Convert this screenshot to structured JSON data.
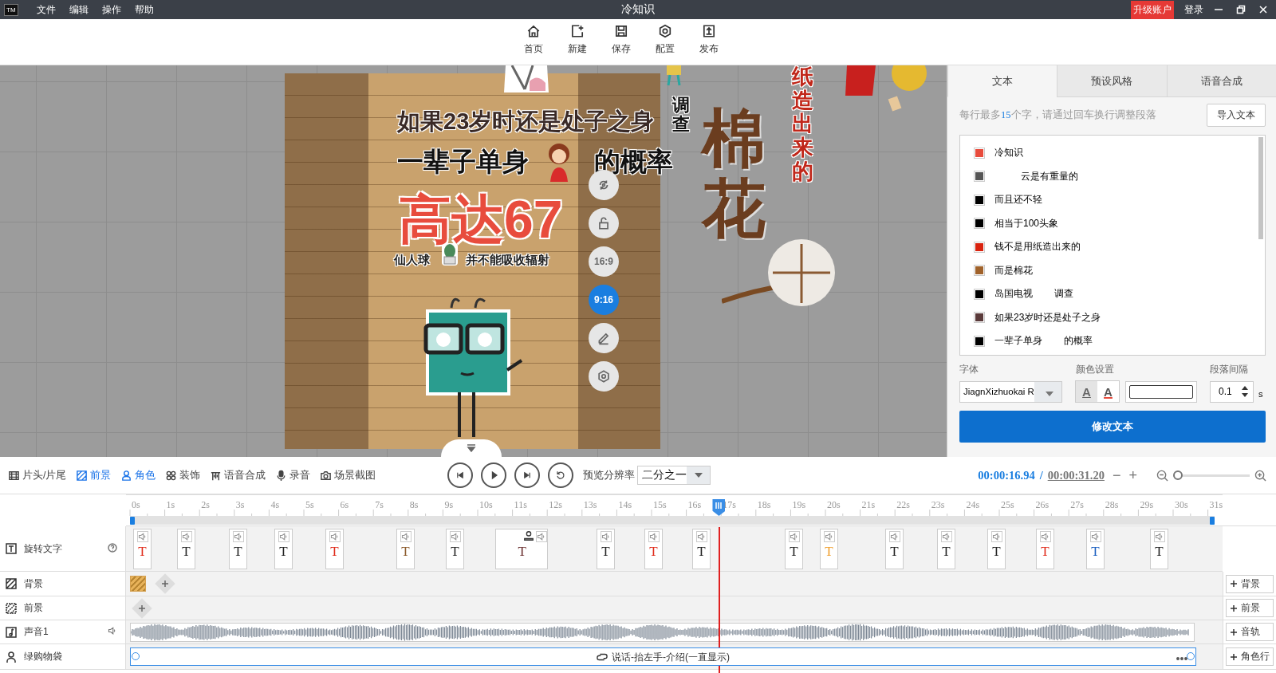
{
  "app": {
    "logo": "TM",
    "menu": [
      "文件",
      "编辑",
      "操作",
      "帮助"
    ],
    "title": "冷知识",
    "upgrade": "升级账户",
    "login": "登录"
  },
  "toolbar": [
    {
      "kind": "home",
      "label": "首页"
    },
    {
      "kind": "new",
      "label": "新建"
    },
    {
      "kind": "save",
      "label": "保存"
    },
    {
      "kind": "settings",
      "label": "配置"
    },
    {
      "kind": "publish",
      "label": "发布"
    }
  ],
  "canvas": {
    "texts": [
      {
        "kind": "headline",
        "text": "如果23岁时还是处子之身"
      },
      {
        "kind": "line",
        "text": "一辈子单身"
      },
      {
        "kind": "line",
        "text": "的概率"
      },
      {
        "kind": "big",
        "text": "高达67"
      },
      {
        "kind": "small",
        "text": "仙人球"
      },
      {
        "kind": "small",
        "text": "并不能吸收辐射"
      },
      {
        "kind": "vertical",
        "text": "调查"
      },
      {
        "kind": "vertical_large",
        "text": "棉花"
      },
      {
        "kind": "vertical_red",
        "text": "纸造出来的"
      }
    ],
    "tools_top": [
      {
        "kind": "rotate"
      },
      {
        "kind": "lock"
      }
    ],
    "aspect_ratios": [
      {
        "label": "16:9",
        "selected": false
      },
      {
        "label": "9:16",
        "selected": true
      }
    ],
    "tools_bottom": [
      {
        "kind": "edit"
      },
      {
        "kind": "settings"
      }
    ]
  },
  "panel": {
    "tabs": [
      {
        "label": "文本",
        "selected": true
      },
      {
        "label": "预设风格",
        "selected": false
      },
      {
        "label": "语音合成",
        "selected": false
      }
    ],
    "hint": "每行最多**15**个字，请通过回车换行调整段落",
    "import_button": "导入文本",
    "lines": [
      {
        "text": "冷知识",
        "color": "#e84c3d"
      },
      {
        "text": "          云是有重量的",
        "color": "#555555"
      },
      {
        "text": "而且还不轻",
        "color": "#000000"
      },
      {
        "text": "相当于100头象",
        "color": "#000000"
      },
      {
        "text": "钱不是用纸造出来的",
        "color": "#d9230f"
      },
      {
        "text": "而是棉花",
        "color": "#a0622a"
      },
      {
        "text": "岛国电视        调查",
        "color": "#000000"
      },
      {
        "text": "如果23岁时还是处子之身",
        "color": "#5a3a3a"
      },
      {
        "text": "一辈子单身        的概率",
        "color": "#000000"
      }
    ],
    "font_label": "字体",
    "font_value": "JiagnXizhuokai R",
    "color_label": "颜色设置",
    "color_buttons": [
      {
        "kind": "plain",
        "label": "A"
      },
      {
        "kind": "colored",
        "label": "A"
      }
    ],
    "spacing_label": "段落间隔",
    "spacing_value": "0.1",
    "spacing_unit": "s",
    "apply_button": "修改文本"
  },
  "playbar": {
    "tools": [
      {
        "kind": "film",
        "label": "片头/片尾",
        "active": false
      },
      {
        "kind": "foreground",
        "label": "前景",
        "active": true
      },
      {
        "kind": "person",
        "label": "角色",
        "active": true
      },
      {
        "kind": "decoration",
        "label": "装饰",
        "active": false
      },
      {
        "kind": "voice",
        "label": "语音合成",
        "active": false
      },
      {
        "kind": "mic",
        "label": "录音",
        "active": false
      },
      {
        "kind": "camera",
        "label": "场景截图",
        "active": false
      }
    ],
    "playback": [
      {
        "kind": "previous"
      },
      {
        "kind": "play"
      },
      {
        "kind": "next"
      },
      {
        "kind": "replay"
      }
    ],
    "resolution_label": "预览分辨率",
    "resolution_value": "二分之一",
    "current_time": "00:00:16.94",
    "separator": "/",
    "total_time": "00:00:31.20",
    "time_buttons": [
      "−",
      "+"
    ],
    "zoom": {
      "level": 0
    }
  },
  "timeline": {
    "ruler": [
      "0s",
      "1s",
      "2s",
      "3s",
      "4s",
      "5s",
      "6s",
      "7s",
      "8s",
      "9s",
      "10s",
      "11s",
      "12s",
      "13s",
      "14s",
      "15s",
      "16s",
      "17s",
      "18s",
      "19s",
      "20s",
      "21s",
      "22s",
      "23s",
      "24s",
      "25s",
      "26s",
      "27s",
      "28s",
      "29s",
      "30s",
      "31s"
    ],
    "playhead": {
      "level": 0.543
    },
    "tracks": [
      {
        "kind": "text",
        "label": "旋转文字",
        "clips": [
          {
            "glyph": "T",
            "color": "#e02a1a"
          },
          {
            "glyph": "T",
            "color": "#222222"
          },
          {
            "glyph": "T",
            "color": "#222222"
          },
          {
            "glyph": "T",
            "color": "#222222"
          },
          {
            "glyph": "T",
            "color": "#e02a1a"
          },
          {
            "glyph": "T",
            "color": "#8b5a2b"
          },
          {
            "glyph": "T",
            "color": "#222222"
          },
          {
            "glyph": "T",
            "color": "#6b3030"
          },
          {
            "glyph": "T",
            "color": "#222222"
          },
          {
            "glyph": "T",
            "color": "#e02a1a"
          },
          {
            "glyph": "T",
            "color": "#222222"
          },
          {
            "glyph": "T",
            "color": "#222222"
          },
          {
            "glyph": "T",
            "color": "#f0a030"
          },
          {
            "glyph": "T",
            "color": "#222222"
          },
          {
            "glyph": "T",
            "color": "#222222"
          },
          {
            "glyph": "T",
            "color": "#222222"
          },
          {
            "glyph": "T",
            "color": "#e02a1a"
          },
          {
            "glyph": "T",
            "color": "#1a5fc0"
          },
          {
            "glyph": "T",
            "color": "#222222"
          }
        ]
      },
      {
        "kind": "background",
        "label": "背景",
        "add_button": "背景"
      },
      {
        "kind": "foreground",
        "label": "前景",
        "add_button": "前景"
      },
      {
        "kind": "audio",
        "label": "声音1",
        "add_button": "音轨"
      },
      {
        "kind": "character",
        "label": "绿购物袋",
        "clip": "说话-抬左手-介绍(一直显示)",
        "add_button": "角色行"
      }
    ]
  }
}
